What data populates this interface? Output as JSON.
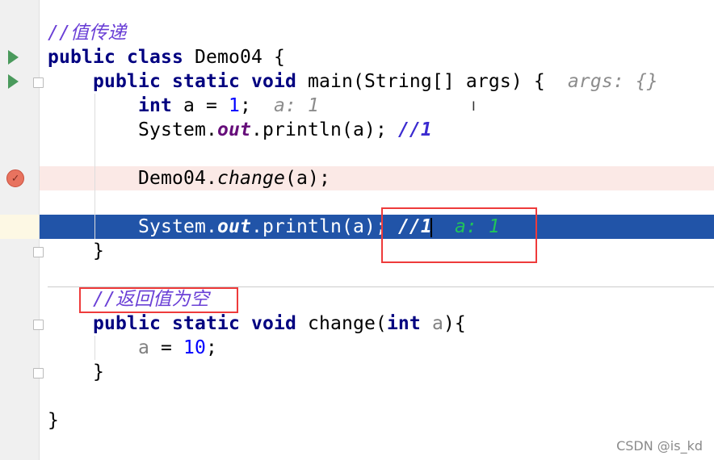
{
  "editor": {
    "lines": [
      {
        "tokens": [
          [
            "cm",
            "//值传递"
          ]
        ]
      },
      {
        "tokens": [
          [
            "kw",
            "public class "
          ],
          [
            "",
            "Demo04 {"
          ]
        ]
      },
      {
        "tokens": [
          [
            "",
            "    "
          ],
          [
            "kw",
            "public static void "
          ],
          [
            "",
            "main(String[] args) {  "
          ],
          [
            "hint",
            "args: {}"
          ]
        ]
      },
      {
        "tokens": [
          [
            "",
            "        "
          ],
          [
            "kw",
            "int "
          ],
          [
            "",
            "a = "
          ],
          [
            "num",
            "1"
          ],
          [
            "",
            ";  "
          ],
          [
            "hint",
            "a: 1"
          ]
        ]
      },
      {
        "tokens": [
          [
            "",
            "        System."
          ],
          [
            "st",
            "out"
          ],
          [
            "",
            ".println(a); "
          ],
          [
            "cmb",
            "//1"
          ]
        ]
      },
      {
        "tokens": []
      },
      {
        "tokens": [
          [
            "",
            "        Demo04."
          ],
          [
            "it",
            "change"
          ],
          [
            "",
            "(a);"
          ]
        ]
      },
      {
        "tokens": []
      },
      {
        "tokens": [
          [
            "",
            "        System."
          ],
          [
            "st",
            "out"
          ],
          [
            "",
            ".println(a); "
          ],
          [
            "cmb",
            "//1"
          ],
          [
            "",
            "  "
          ],
          [
            "hint",
            "a: 1"
          ]
        ]
      },
      {
        "tokens": [
          [
            "",
            "    }"
          ]
        ]
      },
      {
        "tokens": [
          [
            "",
            "    "
          ],
          [
            "cm",
            "//返回值为空"
          ]
        ]
      },
      {
        "tokens": [
          [
            "",
            "    "
          ],
          [
            "kw",
            "public "
          ],
          [
            "kw",
            "static void "
          ],
          [
            "",
            "change("
          ],
          [
            "kw",
            "int "
          ],
          [
            "par",
            "a"
          ],
          [
            "",
            "){"
          ]
        ]
      },
      {
        "tokens": [
          [
            "",
            "        "
          ],
          [
            "par",
            "a"
          ],
          [
            "",
            " = "
          ],
          [
            "num",
            "10"
          ],
          [
            "",
            ";"
          ]
        ]
      },
      {
        "tokens": [
          [
            "",
            "    }"
          ]
        ]
      },
      {
        "tokens": []
      },
      {
        "tokens": [
          [
            "",
            "}"
          ]
        ]
      }
    ]
  },
  "watermark": "CSDN @is_kd",
  "colors": {
    "execution_line": "#2154a8",
    "breakpoint_line": "#fbe9e6",
    "annotation_box": "#ee3b3b"
  }
}
